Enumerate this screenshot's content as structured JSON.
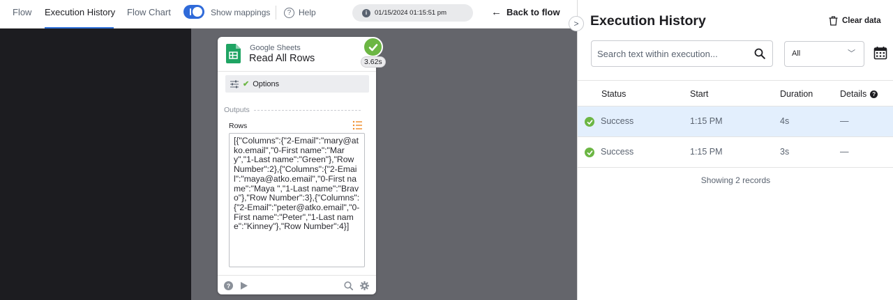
{
  "topbar": {
    "tabs": [
      {
        "label": "Flow"
      },
      {
        "label": "Execution History"
      },
      {
        "label": "Flow Chart"
      }
    ],
    "show_mappings": {
      "label": "Show mappings",
      "enabled": true
    },
    "help_label": "Help",
    "timestamp": "01/15/2024 01:15:51 pm",
    "back_label": "Back to flow"
  },
  "card": {
    "app_name": "Google Sheets",
    "action_name": "Read All Rows",
    "duration_badge": "3.62s",
    "status": "success",
    "options_label": "Options",
    "outputs_label": "Outputs",
    "rows_label": "Rows",
    "rows_value": "[{\"Columns\":{\"2-Email\":\"mary@atko.email\",\"0-First name\":\"Mary\",\"1-Last name\":\"Green\"},\"Row Number\":2},{\"Columns\":{\"2-Email\":\"maya@atko.email\",\"0-First name\":\"Maya \",\"1-Last name\":\"Bravo\"},\"Row Number\":3},{\"Columns\":{\"2-Email\":\"peter@atko.email\",\"0-First name\":\"Peter\",\"1-Last name\":\"Kinney\"},\"Row Number\":4}]"
  },
  "panel": {
    "title": "Execution History",
    "clear_label": "Clear data",
    "search_placeholder": "Search text within execution...",
    "filter_value": "All",
    "columns": [
      "Status",
      "Start",
      "Duration",
      "Details"
    ],
    "rows": [
      {
        "status": "Success",
        "start": "1:15 PM",
        "duration": "4s",
        "details": "—",
        "selected": true
      },
      {
        "status": "Success",
        "start": "1:15 PM",
        "duration": "3s",
        "details": "—",
        "selected": false
      }
    ],
    "footer": "Showing 2 records"
  },
  "colors": {
    "accent": "#2e6fd8",
    "success": "#6cb644",
    "selected_row": "#e3effd",
    "canvas": "#64656b"
  }
}
